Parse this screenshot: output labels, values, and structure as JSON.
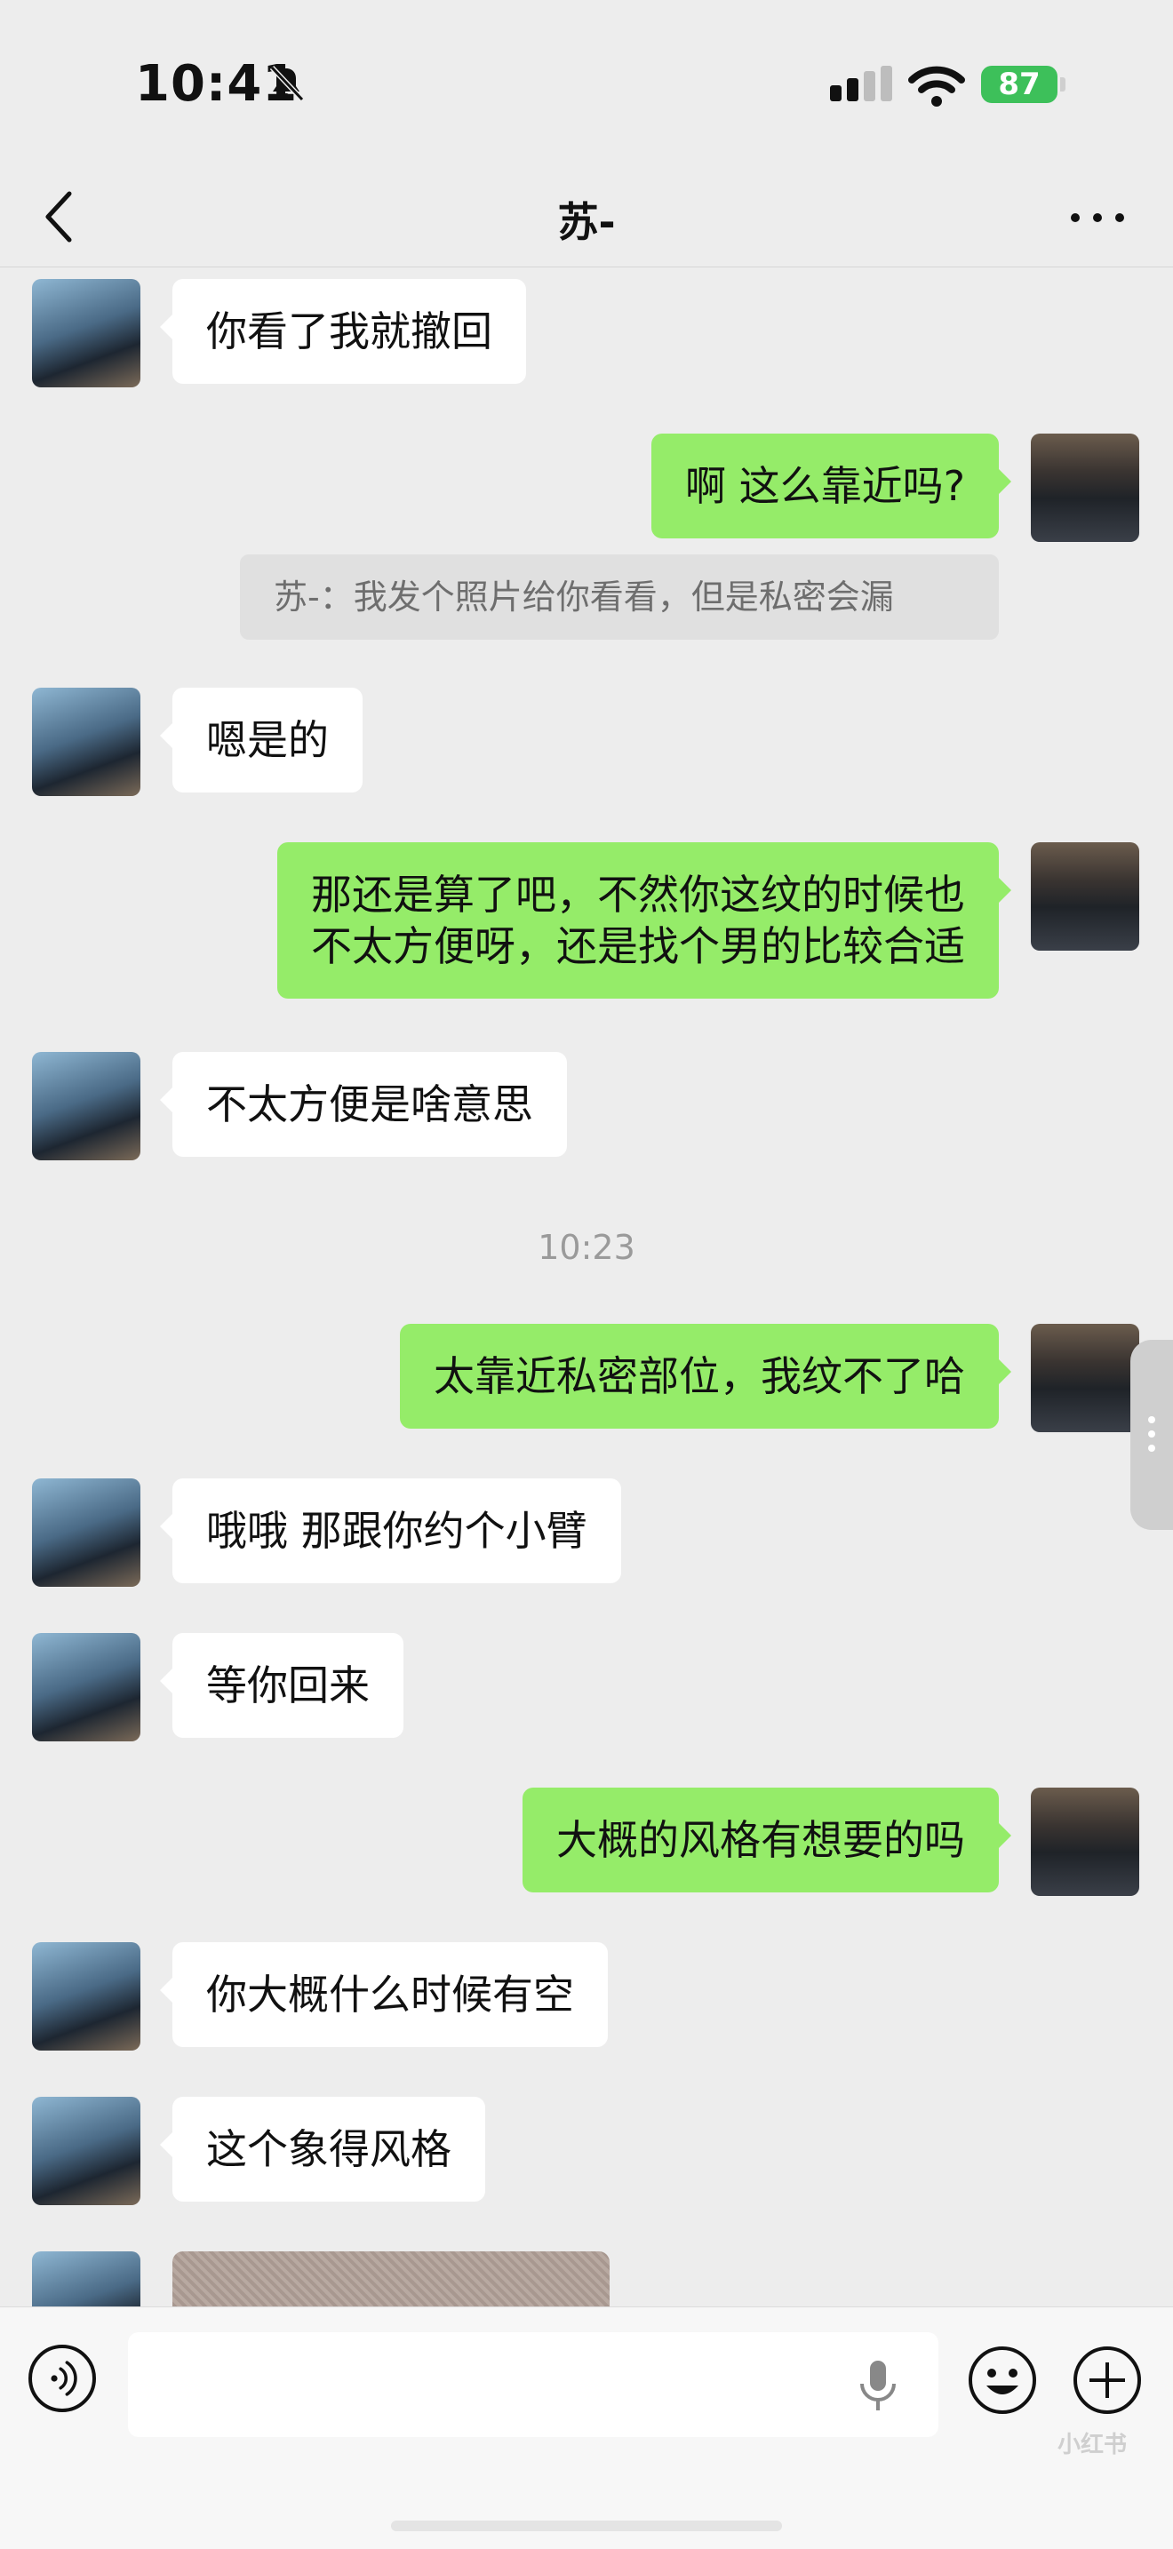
{
  "status_bar": {
    "time": "10:41",
    "battery": "87"
  },
  "nav": {
    "title": "苏-"
  },
  "messages": [
    {
      "side": "left",
      "text": "你看了我就撤回"
    },
    {
      "side": "right",
      "text": "啊 这么靠近吗?"
    },
    {
      "type": "quote",
      "text": "苏-：我发个照片给你看看，但是私密会漏"
    },
    {
      "side": "left",
      "text": "嗯是的"
    },
    {
      "side": "right",
      "text": "那还是算了吧，不然你这纹的时候也\n不太方便呀，还是找个男的比较合适"
    },
    {
      "side": "left",
      "text": "不太方便是啥意思"
    },
    {
      "type": "time",
      "text": "10:23"
    },
    {
      "side": "right",
      "text": "太靠近私密部位，我纹不了哈"
    },
    {
      "side": "left",
      "text": "哦哦  那跟你约个小臂"
    },
    {
      "side": "left",
      "text": "等你回来"
    },
    {
      "side": "right",
      "text": "大概的风格有想要的吗"
    },
    {
      "side": "left",
      "text": "你大概什么时候有空"
    },
    {
      "side": "left",
      "text": "这个象得风格"
    }
  ],
  "input_bar": {
    "placeholder": ""
  },
  "watermark": "小红书",
  "colors": {
    "background": "#ededed",
    "bubble_me": "#95ec69",
    "bubble_them": "#ffffff"
  },
  "icons": [
    "bell-slash-icon",
    "signal-icon",
    "wifi-icon",
    "battery-icon",
    "back-chevron-icon",
    "more-icon",
    "voice-icon",
    "microphone-icon",
    "emoji-icon",
    "plus-icon"
  ]
}
